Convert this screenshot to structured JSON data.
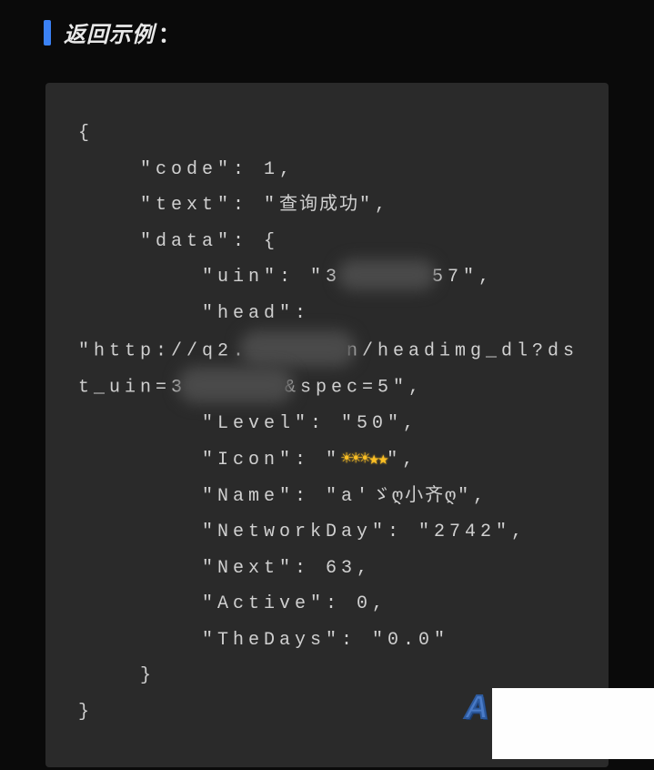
{
  "header": {
    "title": "返回示例",
    "colon": "："
  },
  "code": {
    "open_brace": "{",
    "line_code": "    \"code\": 1,",
    "line_text_pre": "    \"text\": \"",
    "line_text_val": "查询成功",
    "line_text_post": "\",",
    "line_data": "    \"data\": {",
    "line_uin_pre": "        \"uin\": \"3",
    "line_uin_post": "57\",",
    "line_head": "        \"head\": ",
    "line_head_url_pre": "\"http://q2.",
    "line_head_url_mid": "n/headimg_dl?dst_uin=3",
    "line_head_url_post": "&spec=5\",",
    "line_level": "        \"Level\": \"50\",",
    "line_icon_pre": "        \"Icon\": \"",
    "line_icon_stars": "☀☀☀★★",
    "line_icon_post": "\",",
    "line_name_pre": "        \"Name\": \"a'",
    "line_name_val": "ゞღ小齐ღ",
    "line_name_post": "\",",
    "line_networkday": "        \"NetworkDay\": \"2742\",",
    "line_next": "        \"Next\": 63,",
    "line_active": "        \"Active\": 0,",
    "line_thedays": "        \"TheDays\": \"0.0\"",
    "close_inner": "    }",
    "close_brace": "}"
  },
  "corner": {
    "letter": "A"
  }
}
